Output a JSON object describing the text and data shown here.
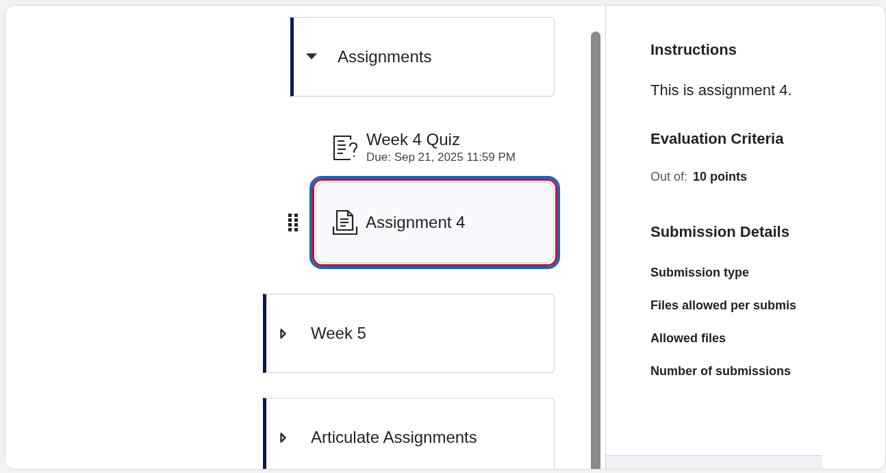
{
  "modules": [
    {
      "title": "Assignments",
      "expanded": true,
      "children": [
        {
          "kind": "quiz",
          "title": "Week 4 Quiz",
          "due": "Due: Sep 21, 2025 11:59 PM",
          "selected": false
        },
        {
          "kind": "assignment",
          "title": "Assignment 4",
          "selected": true
        }
      ]
    },
    {
      "title": "Week 5",
      "expanded": false
    },
    {
      "title": "Articulate Assignments",
      "expanded": false
    }
  ],
  "details": {
    "instructions_heading": "Instructions",
    "instructions_text": "This is assignment 4.",
    "evaluation_heading": "Evaluation Criteria",
    "out_of_label": "Out of:",
    "out_of_value": "10 points",
    "submission_heading": "Submission Details",
    "submission_fields": [
      "Submission type",
      "Files allowed per submis",
      "Allowed files",
      "Number of submissions"
    ]
  }
}
